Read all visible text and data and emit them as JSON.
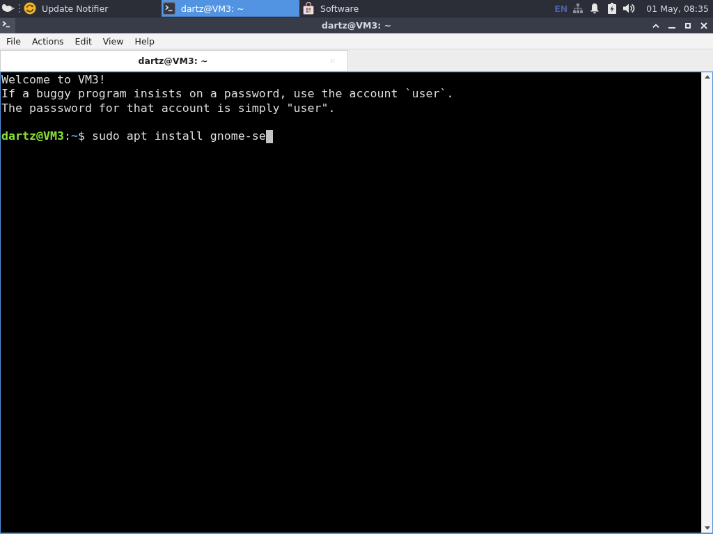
{
  "taskbar": {
    "tasks": [
      {
        "kind": "updater",
        "label": "Update Notifier",
        "selected": false
      },
      {
        "kind": "terminal",
        "label": "dartz@VM3: ~",
        "selected": true
      },
      {
        "kind": "store",
        "label": "Software",
        "selected": false
      }
    ],
    "keyboard_layout": "EN",
    "clock": "01 May, 08:35"
  },
  "window": {
    "title": "dartz@VM3: ~"
  },
  "menu": [
    "File",
    "Actions",
    "Edit",
    "View",
    "Help"
  ],
  "tabs": [
    {
      "label": "dartz@VM3: ~",
      "selected": true
    }
  ],
  "terminal": {
    "lines": [
      "Welcome to VM3!",
      "If a buggy program insists on a password, use the account `user`.",
      "The passsword for that account is simply \"user\"."
    ],
    "prompt": {
      "user_host": "dartz@VM3",
      "separator": ":",
      "path": "~",
      "symbol": "$",
      "command": "sudo apt install gnome-se"
    }
  }
}
